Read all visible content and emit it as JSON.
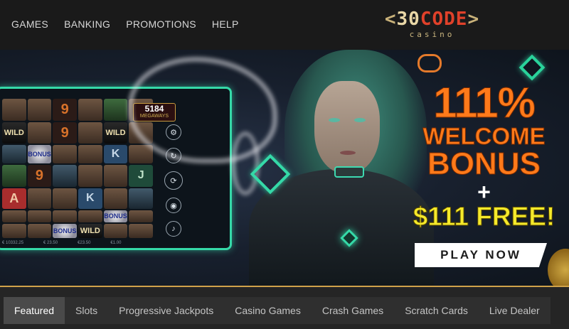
{
  "nav": {
    "items": [
      "GAMES",
      "BANKING",
      "PROMOTIONS",
      "HELP"
    ]
  },
  "logo": {
    "bracket_left": "<",
    "number": "30",
    "word": "CODE",
    "bracket_right": ">",
    "sub": "casino"
  },
  "slot": {
    "counter_value": "5184",
    "counter_label": "MEGAWAYS",
    "wild": "WILD",
    "bonus": "BONUS",
    "nine": "9",
    "a": "A",
    "k": "K",
    "j": "J",
    "bar_balance": "€ 10332.25",
    "bar_bet": "€ 23.50",
    "bar_total": "€23.50",
    "bar_win": "€1.00"
  },
  "promo": {
    "percent": "111%",
    "welcome": "WELCOME",
    "bonus": "BONUS",
    "plus": "+",
    "free": "$111 FREE!",
    "cta": "PLAY NOW"
  },
  "tabs": {
    "items": [
      "Featured",
      "Slots",
      "Progressive Jackpots",
      "Casino Games",
      "Crash Games",
      "Scratch Cards",
      "Live Dealer"
    ],
    "active": "Featured"
  },
  "colors": {
    "accent_orange": "#ff7a1a",
    "accent_yellow": "#f6ea2b",
    "neon_green": "#35d9a8",
    "gold_line": "#d0a24a"
  }
}
